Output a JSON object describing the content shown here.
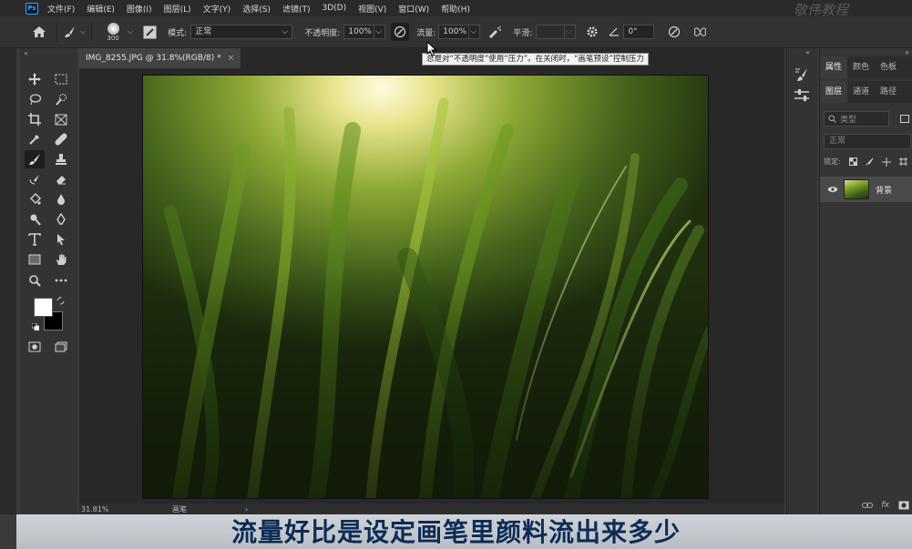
{
  "app": {
    "logo_text": "Ps"
  },
  "menu": [
    "文件(F)",
    "编辑(E)",
    "图像(I)",
    "图层(L)",
    "文字(Y)",
    "选择(S)",
    "滤镜(T)",
    "3D(D)",
    "视图(V)",
    "窗口(W)",
    "帮助(H)"
  ],
  "watermark": "敬伟教程",
  "options": {
    "brush_size": "300",
    "mode_label": "模式:",
    "mode_value": "正常",
    "opacity_label": "不透明度:",
    "opacity_value": "100%",
    "flow_label": "流量:",
    "flow_value": "100%",
    "smoothing_label": "平滑:",
    "smoothing_value": "",
    "angle_value": "0°"
  },
  "tooltip": "总是对“不透明度”使用“压力”。在关闭时，“画笔预设”控制压力",
  "document": {
    "tab_title": "IMG_8255.JPG @ 31.8%(RGB/8) *",
    "close_glyph": "×",
    "zoom": "31.81%",
    "status_text": "画笔",
    "status_arrow": "›"
  },
  "panels": {
    "top_tabs": [
      "属性",
      "颜色",
      "色板"
    ],
    "layer_tabs": [
      "图层",
      "通道",
      "路径"
    ],
    "filter_placeholder": "类型",
    "blend_mode": "正常",
    "lock_label": "锁定:",
    "layers": [
      {
        "name": "背景"
      }
    ],
    "footer_icons": [
      "link-icon",
      "fx-icon",
      "mask-icon"
    ],
    "fx_text": "fx"
  },
  "subtitle": "流量好比是设定画笔里颜料流出来多少",
  "colors": {
    "foreground": "#ffffff",
    "background": "#000000",
    "subtitle": "#0d2b55"
  }
}
